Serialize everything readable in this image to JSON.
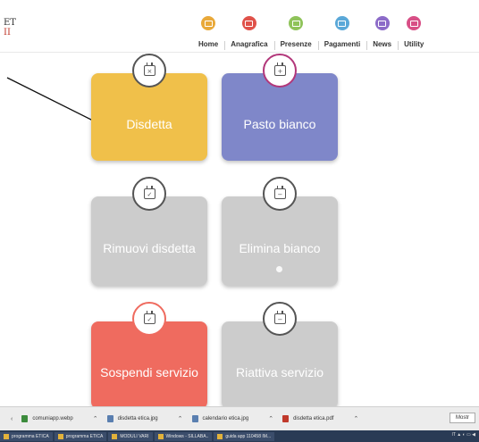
{
  "brand": {
    "line1": "ET",
    "line2": "II"
  },
  "nav": {
    "items": [
      {
        "label": "Home",
        "color": "#e9a93a"
      },
      {
        "label": "Anagrafica",
        "color": "#e0524a"
      },
      {
        "label": "Presenze",
        "color": "#8fc35a"
      },
      {
        "label": "Pagamenti",
        "color": "#5aa8d8"
      },
      {
        "label": "News",
        "color": "#8c6bc8"
      },
      {
        "label": "Utility",
        "color": "#d84f86"
      }
    ]
  },
  "cards": [
    {
      "label": "Disdetta",
      "color": "#f0c04a",
      "icon_glyph": "×",
      "ring": "#555555"
    },
    {
      "label": "Pasto bianco",
      "color": "#7f87c9",
      "icon_glyph": "+",
      "ring": "#b2377a"
    },
    {
      "label": "Rimuovi disdetta",
      "color": "#cccccc",
      "icon_glyph": "✓",
      "ring": "#555555"
    },
    {
      "label": "Elimina bianco",
      "color": "#cccccc",
      "icon_glyph": "−",
      "ring": "#555555"
    },
    {
      "label": "Sospendi servizio",
      "color": "#ef6b5f",
      "icon_glyph": "✓",
      "ring": "#ef6b5f"
    },
    {
      "label": "Riattiva servizio",
      "color": "#cccccc",
      "icon_glyph": "−",
      "ring": "#555555"
    }
  ],
  "downloads": {
    "files": [
      {
        "name": "comuniapp.webp",
        "icon_color": "#3c8b3c"
      },
      {
        "name": "disdetta etica.jpg",
        "icon_color": "#5a7fb0"
      },
      {
        "name": "calendario etica.jpg",
        "icon_color": "#5a7fb0"
      },
      {
        "name": "disdetta etica.pdf",
        "icon_color": "#c0392b"
      }
    ],
    "show_all_label": "Mostr"
  },
  "taskbar": {
    "items": [
      "programma ETICA",
      "programma ETICA",
      "MODULI VARI",
      "Windows - SILLABA..",
      "guida app 110458 IM..."
    ],
    "tray": "IT ▲ ◐ ▭ ◀"
  }
}
